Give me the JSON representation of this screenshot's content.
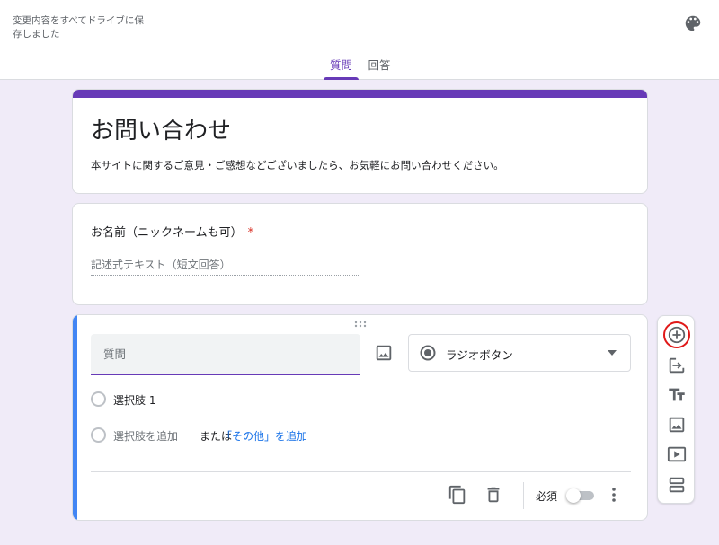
{
  "header": {
    "save_status": "変更内容をすべてドライブに保存しました",
    "palette_icon": "palette-icon",
    "tabs": [
      {
        "label": "質問",
        "active": true
      },
      {
        "label": "回答",
        "active": false
      }
    ]
  },
  "form": {
    "title": "お問い合わせ",
    "description": "本サイトに関するご意見・ご感想などございましたら、お気軽にお問い合わせください。"
  },
  "question1": {
    "title": "お名前（ニックネームも可）",
    "required_mark": "*",
    "answer_placeholder": "記述式テキスト（短文回答）"
  },
  "question2": {
    "title_placeholder": "質問",
    "type_label": "ラジオボタン",
    "options": [
      {
        "label": "選択肢 1"
      }
    ],
    "add_option_label": "選択肢を追加",
    "or_label": "または",
    "add_other_label": "「その他」を追加",
    "required_label": "必須",
    "required_on": false
  },
  "toolbar": {
    "items": [
      "add-question-icon",
      "import-questions-icon",
      "add-title-icon",
      "add-image-icon",
      "add-video-icon",
      "add-section-icon"
    ]
  },
  "colors": {
    "accent": "#673ab7",
    "focus_bar": "#4285f4",
    "background": "#f0ebf8",
    "link": "#1a73e8",
    "highlight": "#e01818"
  }
}
